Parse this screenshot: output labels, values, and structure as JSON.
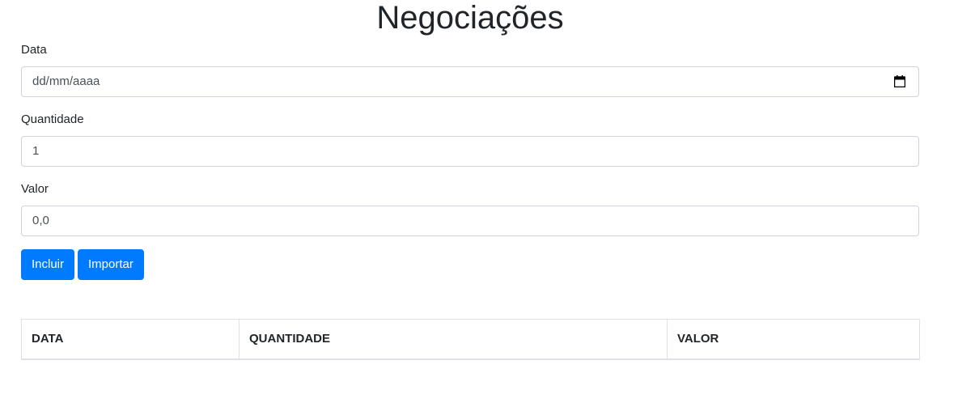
{
  "page": {
    "title": "Negociações"
  },
  "form": {
    "data": {
      "label": "Data",
      "placeholder": "dd/mm/aaaa",
      "icon": "calendar-icon"
    },
    "quantidade": {
      "label": "Quantidade",
      "value": "1"
    },
    "valor": {
      "label": "Valor",
      "value": "0,0"
    }
  },
  "buttons": {
    "incluir": "Incluir",
    "importar": "Importar"
  },
  "table": {
    "headers": [
      "DATA",
      "QUANTIDADE",
      "VALOR"
    ]
  },
  "colors": {
    "primary": "#007bff",
    "text": "#212529",
    "border": "#ced4da"
  }
}
